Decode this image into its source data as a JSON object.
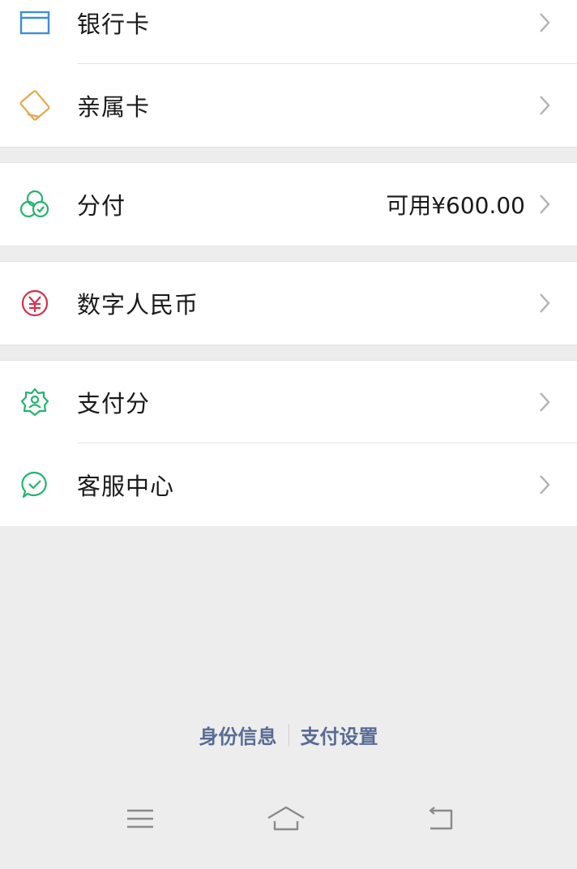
{
  "menu_groups": [
    {
      "items": [
        {
          "label": "银行卡",
          "icon": "bank-card-icon"
        },
        {
          "label": "亲属卡",
          "icon": "family-card-icon"
        }
      ]
    },
    {
      "items": [
        {
          "label": "分付",
          "icon": "fenfu-icon",
          "value": "可用¥600.00"
        }
      ]
    },
    {
      "items": [
        {
          "label": "数字人民币",
          "icon": "digital-rmb-icon"
        }
      ]
    },
    {
      "items": [
        {
          "label": "支付分",
          "icon": "pay-score-icon"
        },
        {
          "label": "客服中心",
          "icon": "customer-service-icon"
        }
      ]
    }
  ],
  "footer": {
    "identity_link": "身份信息",
    "settings_link": "支付设置"
  },
  "colors": {
    "link": "#576b95",
    "background": "#ededed",
    "bank_icon": "#3d8fd6",
    "family_icon": "#e9a64a",
    "green_icon": "#23b46e",
    "rmb_icon": "#d6304d"
  },
  "nav_bar": {
    "menu": "menu-icon",
    "home": "home-icon",
    "back": "back-icon"
  }
}
